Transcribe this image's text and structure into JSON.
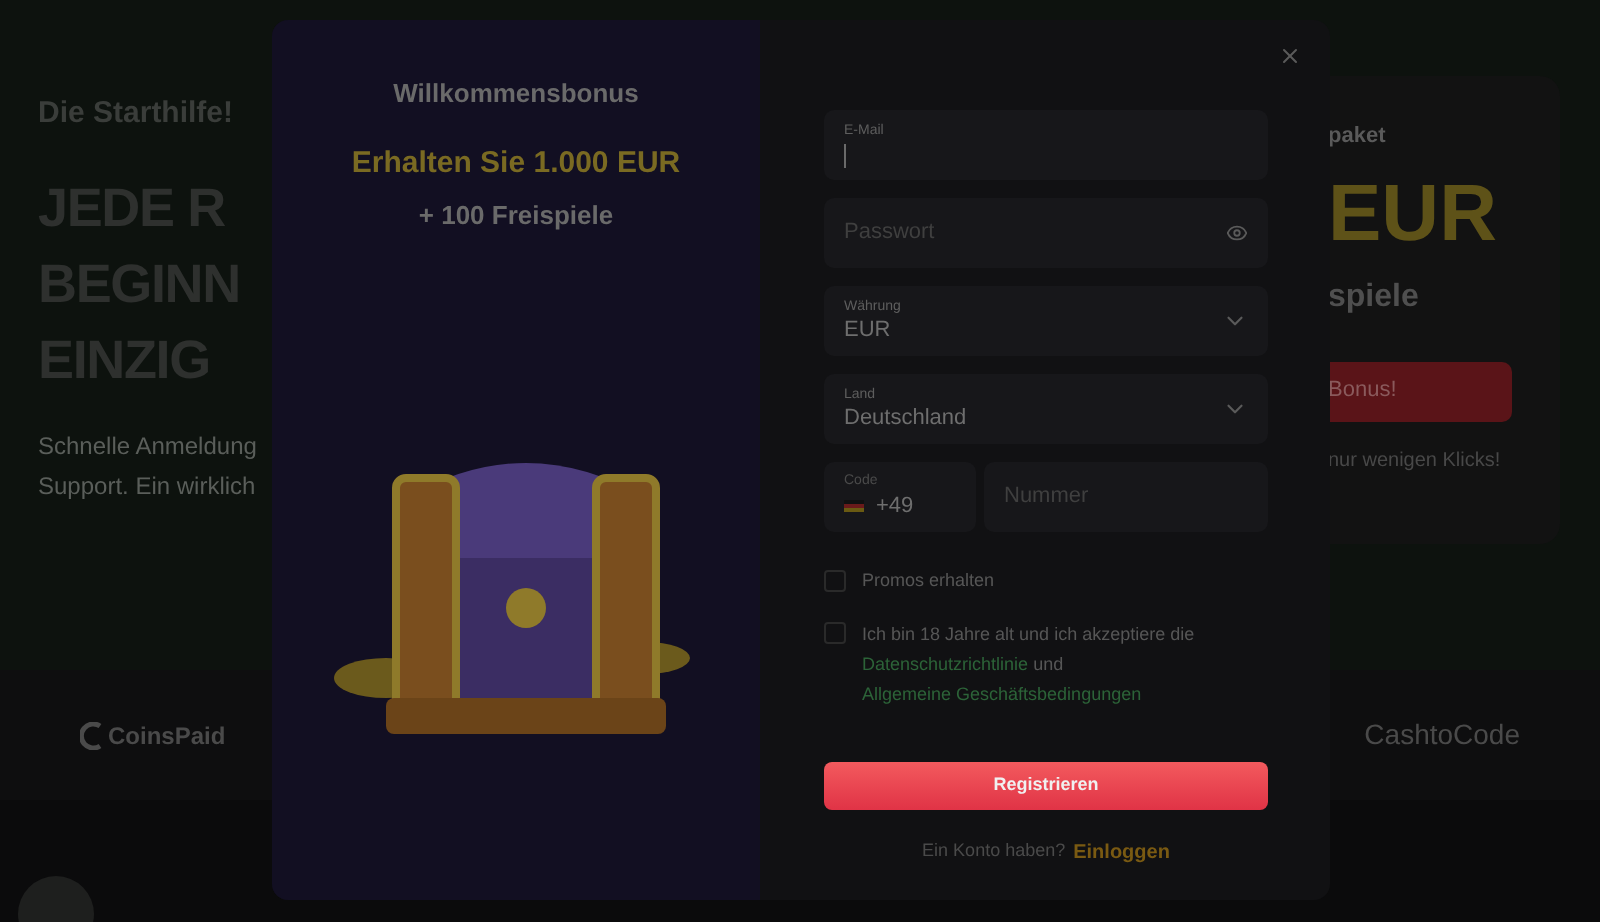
{
  "background": {
    "hero": {
      "eyebrow": "Die Starthilfe!",
      "headline_lines": [
        "JEDE R",
        "BEGINN",
        "EINZIG"
      ],
      "description_lines": [
        "Schnelle Anmeldung",
        "Support. Ein wirklich"
      ]
    },
    "promo_card": {
      "label": "paket",
      "amount": "EUR",
      "spins": "spiele",
      "button": "Bonus!",
      "note": "nur wenigen Klicks!"
    },
    "payment_logos": [
      {
        "kind": "coinspaid",
        "name": "CoinsPaid"
      },
      {
        "kind": "cashtocode",
        "name": "CashtoCode"
      }
    ]
  },
  "modal": {
    "bonus": {
      "title": "Willkommensbonus",
      "offer": "Erhalten Sie 1.000 EUR",
      "spins": "+ 100 Freispiele"
    },
    "fields": [
      {
        "kind": "text",
        "label": "E-Mail",
        "focused": true
      },
      {
        "kind": "password",
        "placeholder": "Passwort"
      },
      {
        "kind": "select",
        "label": "Währung",
        "value": "EUR"
      },
      {
        "kind": "select",
        "label": "Land",
        "value": "Deutschland"
      }
    ],
    "phone": {
      "code_label": "Code",
      "code": "+49",
      "placeholder": "Nummer"
    },
    "checkboxes": [
      {
        "kind": "plain",
        "label": "Promos erhalten",
        "checked": false
      },
      {
        "kind": "terms",
        "label": "Ich bin 18 Jahre alt und ich akzeptiere die",
        "link_1": "Datenschutzrichtlinie",
        "joiner": "und",
        "link_2": "Allgemeine Geschäftsbedingungen",
        "checked": false
      }
    ],
    "submit": "Registrieren",
    "login": {
      "prompt": "Ein Konto haben?",
      "link": "Einloggen"
    }
  }
}
